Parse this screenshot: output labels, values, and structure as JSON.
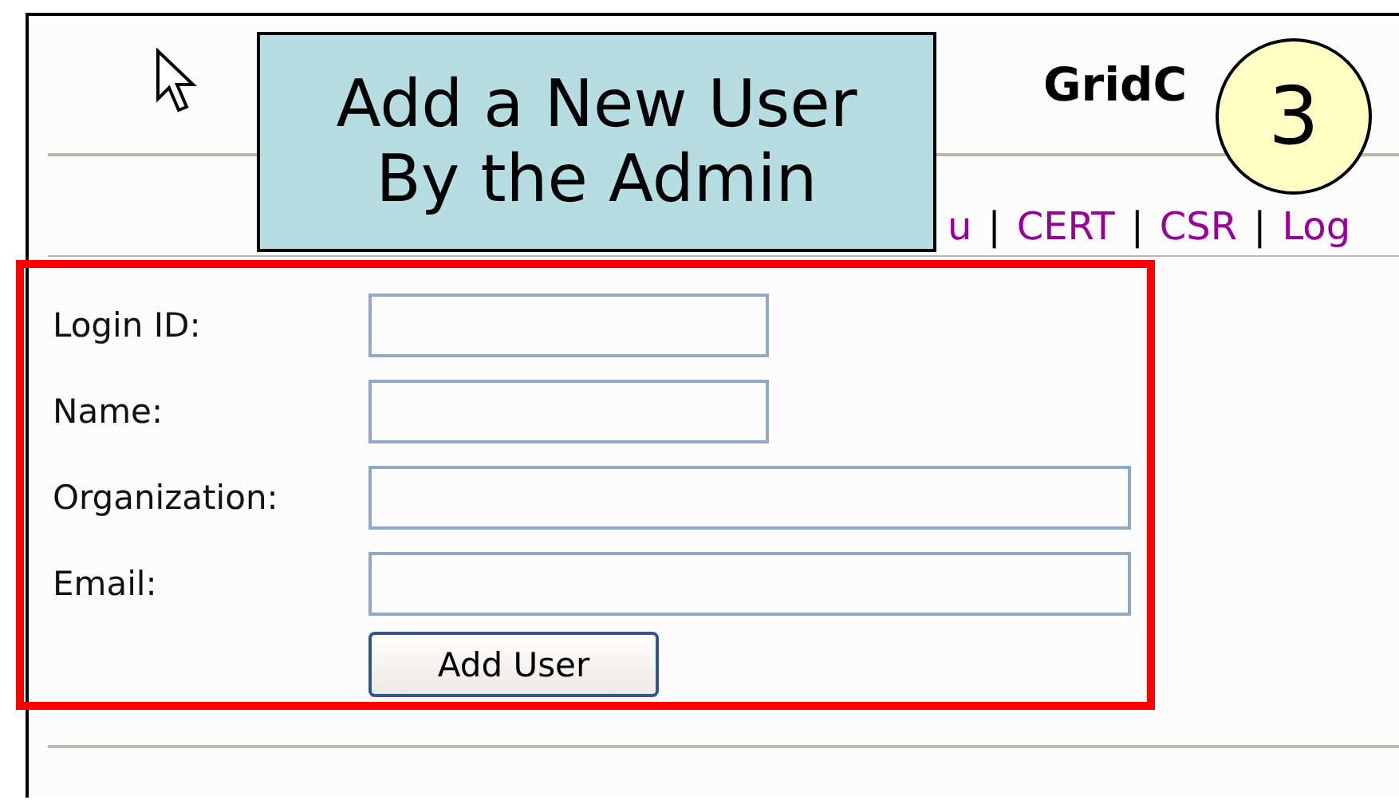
{
  "header": {
    "title": "GridC"
  },
  "nav": [
    {
      "kind": "link",
      "label": "u"
    },
    {
      "kind": "separator",
      "label": "|"
    },
    {
      "kind": "link",
      "label": "CERT"
    },
    {
      "kind": "separator",
      "label": "|"
    },
    {
      "kind": "link",
      "label": "CSR"
    },
    {
      "kind": "separator",
      "label": "|"
    },
    {
      "kind": "link",
      "label": "Log"
    }
  ],
  "form": {
    "fields": [
      {
        "label": "Login ID:",
        "kind": "short"
      },
      {
        "label": "Name:",
        "kind": "short"
      },
      {
        "label": "Organization:",
        "kind": "long"
      },
      {
        "label": "Email:",
        "kind": "long"
      }
    ],
    "button": "Add User"
  },
  "callout": {
    "lines": [
      "Add a New User",
      "By the Admin"
    ]
  },
  "step_badge": "3"
}
